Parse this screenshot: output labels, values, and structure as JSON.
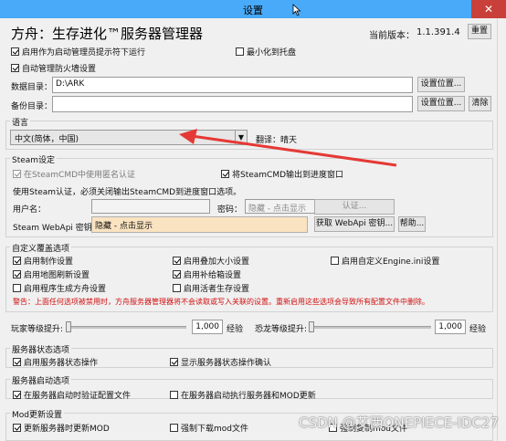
{
  "window": {
    "title": "设置",
    "close_glyph": "✕"
  },
  "header": {
    "app_title": "方舟：生存进化™服务器管理器",
    "version_label": "当前版本：",
    "version": "1.1.391.4",
    "reset_button": "重置"
  },
  "general": {
    "run_as_admin": {
      "label": "启用作为启动管理员提示符下运行",
      "checked": true
    },
    "minimize_to_tray": {
      "label": "最小化到托盘",
      "checked": false
    },
    "auto_firewall": {
      "label": "自动管理防火墙设置",
      "checked": true
    },
    "data_dir_label": "数据目录：",
    "data_dir_value": "D:\\ARK",
    "data_dir_button": "设置位置...",
    "backup_dir_label": "备份目录：",
    "backup_dir_value": "",
    "backup_dir_button": "设置位置...",
    "clear_button": "清除"
  },
  "language": {
    "group_title": "语言",
    "selected": "中文(简体，中国)",
    "translator_label": "翻译：",
    "translator": "晴天"
  },
  "steam": {
    "group_title": "Steam设定",
    "anonymous": {
      "label": "在SteamCMD中使用匿名认证",
      "checked": true
    },
    "output_progress": {
      "label": "将SteamCMD输出到进度窗口",
      "checked": true
    },
    "auth_note": "使用Steam认证，必须关闭输出SteamCMD到进度窗口选项。",
    "username_label": "用户名：",
    "username_value": "",
    "password_label": "密码：",
    "password_placeholder": "隐藏 - 点击显示",
    "auth_button": "认证...",
    "webapi_label": "Steam WebApi 密钥:",
    "webapi_placeholder": "隐藏 - 点击显示",
    "webapi_button": "获取 WebApi 密钥...",
    "help_button": "帮助..."
  },
  "custom": {
    "group_title": "自定义覆盖选项",
    "options": [
      {
        "label": "启用制作设置",
        "checked": true
      },
      {
        "label": "启用叠加大小设置",
        "checked": true
      },
      {
        "label": "启用自定义Engine.ini设置",
        "checked": false
      },
      {
        "label": "启用地图刷新设置",
        "checked": true
      },
      {
        "label": "启用补给箱设置",
        "checked": true
      },
      {
        "label": "启用程序生成方舟设置",
        "checked": false
      },
      {
        "label": "启用活者生存设置",
        "checked": false
      }
    ],
    "warning": "警告：上面任何选项被禁用时，方舟服务器管理器将不会读取或写入关联的设置。重新启用这些选项会导致所有配置文件中删除。"
  },
  "levels": {
    "player_label": "玩家等级提升:",
    "player_value": "1,000",
    "player_unit": "经验",
    "dino_label": "恐龙等级提升:",
    "dino_value": "1,000",
    "dino_unit": "经验"
  },
  "status": {
    "group_title": "服务器状态选项",
    "enable": {
      "label": "启用服务器状态操作",
      "checked": true
    },
    "confirm": {
      "label": "显示服务器状态操作确认",
      "checked": true
    }
  },
  "startup": {
    "group_title": "服务器启动选项",
    "validate": {
      "label": "在服务器启动时验证配置文件",
      "checked": true
    },
    "run_mod_update": {
      "label": "在服务器启动执行服务器和MOD更新",
      "checked": false
    }
  },
  "mod": {
    "group_title": "Mod更新设置",
    "update_mod": {
      "label": "更新服务器时更新MOD",
      "checked": true
    },
    "force_download": {
      "label": "强制下载mod文件",
      "checked": false
    },
    "third": {
      "label": "强制复制mod文件",
      "checked": false
    }
  },
  "watermark": "CSDN @艾西ONEPIECE-IDC27",
  "colors": {
    "titlebar": "#48aaf8",
    "close": "#c9403a",
    "arrow": "#e53935",
    "warning": "#d01010",
    "highlight": "#fae3c0"
  }
}
